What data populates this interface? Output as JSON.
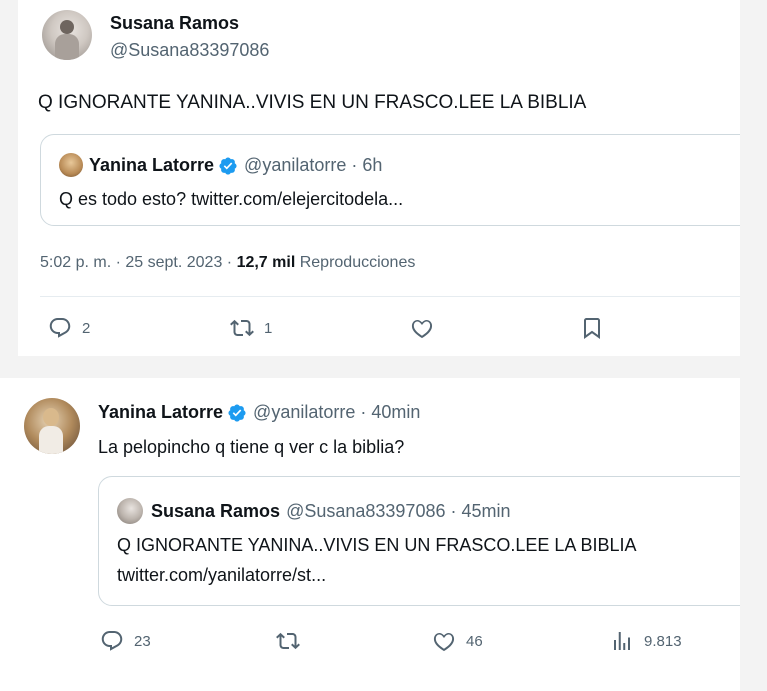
{
  "tweet1": {
    "author_name": "Susana Ramos",
    "author_handle": "@Susana83397086",
    "text": "Q IGNORANTE YANINA..VIVIS EN UN FRASCO.LEE LA BIBLIA",
    "quote": {
      "author_name": "Yanina Latorre",
      "author_handle": "@yanilatorre",
      "time": "· 6h",
      "text": "Q es todo esto? twitter.com/elejercitodela..."
    },
    "meta": {
      "timestamp": "5:02 p. m. · 25 sept. 2023 · ",
      "views": "12,7 mil",
      "views_label": " Reproducciones"
    },
    "actions": {
      "replies": "2",
      "retweets": "1"
    }
  },
  "tweet2": {
    "author_name": "Yanina Latorre",
    "author_handle": "@yanilatorre",
    "time": "· 40min",
    "text": "La pelopincho q tiene q ver c la biblia?",
    "quote": {
      "author_name": "Susana Ramos",
      "author_handle": "@Susana83397086",
      "time": "· 45min",
      "text_line1": "Q IGNORANTE YANINA..VIVIS EN UN FRASCO.LEE LA BIBLIA",
      "text_line2": "twitter.com/yanilatorre/st..."
    },
    "actions": {
      "replies": "23",
      "likes": "46",
      "views": "9.813"
    }
  },
  "colors": {
    "verified": "#1d9bf0",
    "secondary": "#536471"
  },
  "icons": [
    "verified-badge-icon",
    "reply-icon",
    "retweet-icon",
    "like-icon",
    "bookmark-icon",
    "views-icon"
  ]
}
